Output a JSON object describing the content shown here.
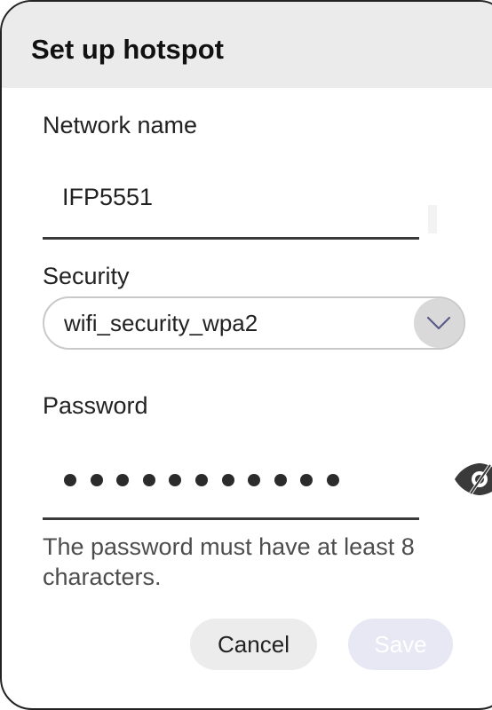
{
  "dialog": {
    "title": "Set up hotspot"
  },
  "network": {
    "label": "Network name",
    "value": "IFP5551"
  },
  "security": {
    "label": "Security",
    "selected": "wifi_security_wpa2",
    "arrow_icon": "chevron-down-icon"
  },
  "password": {
    "label": "Password",
    "masked": "●●●●●●●●●●●●●",
    "visibility_icon": "eye-off-icon",
    "help": "The password must have at least 8 characters."
  },
  "buttons": {
    "cancel": "Cancel",
    "save": "Save"
  },
  "colors": {
    "header_bg": "#ebebeb",
    "dialog_border": "#222222",
    "cancel_bg": "#ececec",
    "save_bg_disabled": "#e8e8f4",
    "arrow_bg": "#d9d9d9",
    "arrow_stroke": "#5a5a8a"
  }
}
